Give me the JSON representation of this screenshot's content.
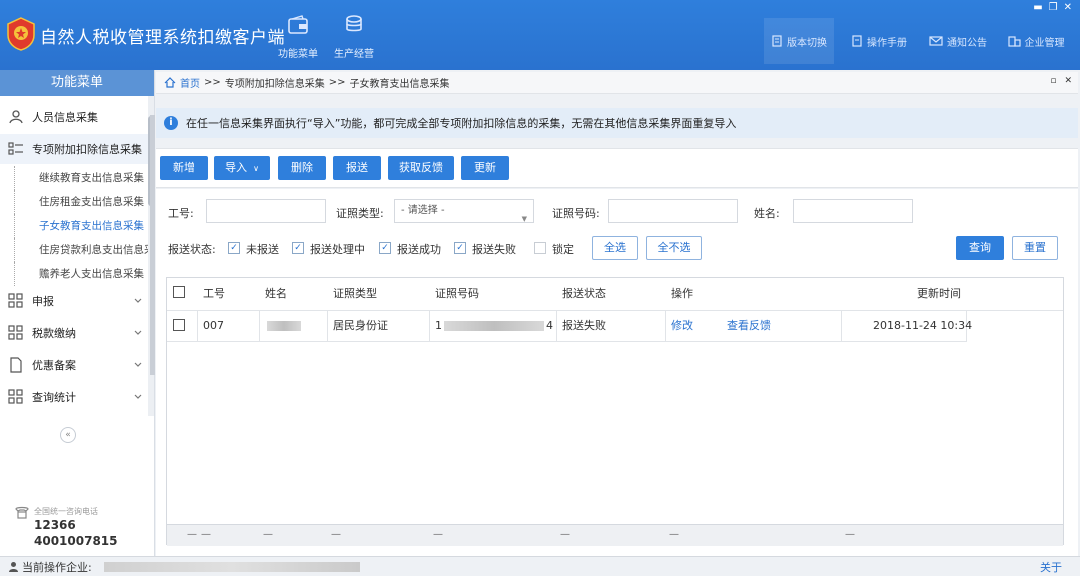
{
  "app": {
    "title": "自然人税收管理系统扣缴客户端"
  },
  "top_nav": [
    {
      "label": "功能菜单",
      "icon": "wallet-icon"
    },
    {
      "label": "生产经营",
      "icon": "coins-icon"
    }
  ],
  "right_nav": [
    {
      "label": "版本切换",
      "icon": "document-icon"
    },
    {
      "label": "操作手册",
      "icon": "book-icon"
    },
    {
      "label": "通知公告",
      "icon": "mail-icon"
    },
    {
      "label": "企业管理",
      "icon": "building-icon"
    }
  ],
  "sidebar": {
    "title": "功能菜单",
    "items": [
      {
        "label": "人员信息采集"
      },
      {
        "label": "专项附加扣除信息采集"
      },
      {
        "label": "申报"
      },
      {
        "label": "税款缴纳"
      },
      {
        "label": "优惠备案"
      },
      {
        "label": "查询统计"
      }
    ],
    "sub_items": [
      {
        "label": "继续教育支出信息采集"
      },
      {
        "label": "住房租金支出信息采集"
      },
      {
        "label": "子女教育支出信息采集"
      },
      {
        "label": "住房贷款利息支出信息采"
      },
      {
        "label": "赡养老人支出信息采集"
      }
    ],
    "collapse": "«",
    "hotline_label": "全国统一咨询电话",
    "hotline_1": "12366",
    "hotline_2": "4001007815"
  },
  "breadcrumb": {
    "home": "首页",
    "sep": ">>",
    "level1": "专项附加扣除信息采集",
    "level2": "子女教育支出信息采集",
    "restore": "▫",
    "close": "✕"
  },
  "notice": {
    "icon": "i",
    "text": "在任一信息采集界面执行“导入”功能，都可完成全部专项附加扣除信息的采集，无需在其他信息采集界面重复导入"
  },
  "toolbar": {
    "add": "新增",
    "import": "导入",
    "delete": "删除",
    "submit": "报送",
    "feedback": "获取反馈",
    "update": "更新"
  },
  "filter": {
    "emp_no_label": "工号:",
    "id_type_label": "证照类型:",
    "id_type_placeholder": "- 请选择 -",
    "id_no_label": "证照号码:",
    "name_label": "姓名:",
    "status_label": "报送状态:",
    "statuses": [
      {
        "label": "未报送",
        "checked": true
      },
      {
        "label": "报送处理中",
        "checked": true
      },
      {
        "label": "报送成功",
        "checked": true
      },
      {
        "label": "报送失败",
        "checked": true
      },
      {
        "label": "锁定",
        "checked": false
      }
    ],
    "select_all": "全选",
    "select_none": "全不选",
    "query": "查询",
    "reset": "重置"
  },
  "table": {
    "columns": [
      "工号",
      "姓名",
      "证照类型",
      "证照号码",
      "报送状态",
      "操作",
      "更新时间"
    ],
    "rows": [
      {
        "emp_no": "007",
        "id_type": "居民身份证",
        "id_no_prefix": "1",
        "id_no_suffix": "4",
        "status": "报送失败",
        "op_edit": "修改",
        "op_feedback": "查看反馈",
        "updated": "2018-11-24 10:34"
      }
    ],
    "footer_dash": "—"
  },
  "status_bar": {
    "label": "当前操作企业:",
    "about": "关于"
  },
  "window": {
    "minimize": "▬",
    "restore": "❐",
    "close": "✕"
  }
}
